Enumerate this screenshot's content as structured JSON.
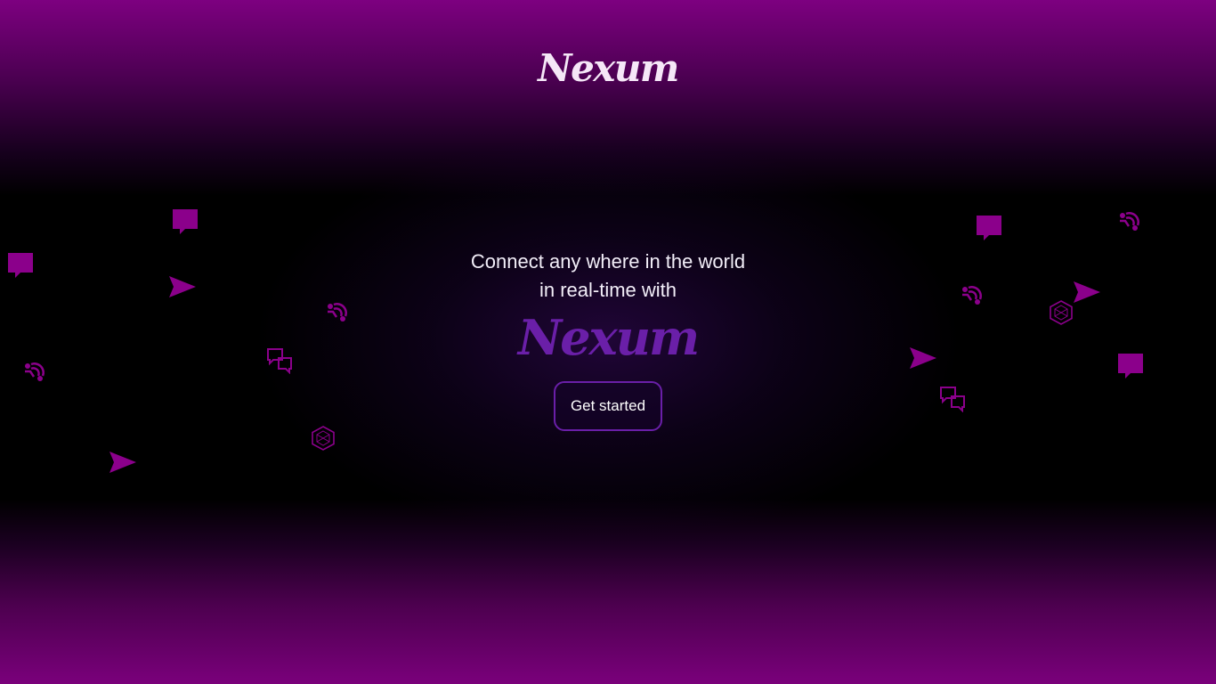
{
  "header": {
    "brand": "Nexum"
  },
  "hero": {
    "tagline_line1": "Connect any where in the world",
    "tagline_line2": "in real-time with",
    "brand": "Nexum",
    "cta_label": "Get started"
  },
  "theme": {
    "accent": "#8b008b",
    "brand_purple": "#6a1fa8",
    "text": "#f5e7f7"
  },
  "decorations": {
    "icons": [
      "chat-bubble-icon",
      "send-icon",
      "people-signal-icon",
      "conversation-icon",
      "hexagon-network-icon"
    ]
  }
}
